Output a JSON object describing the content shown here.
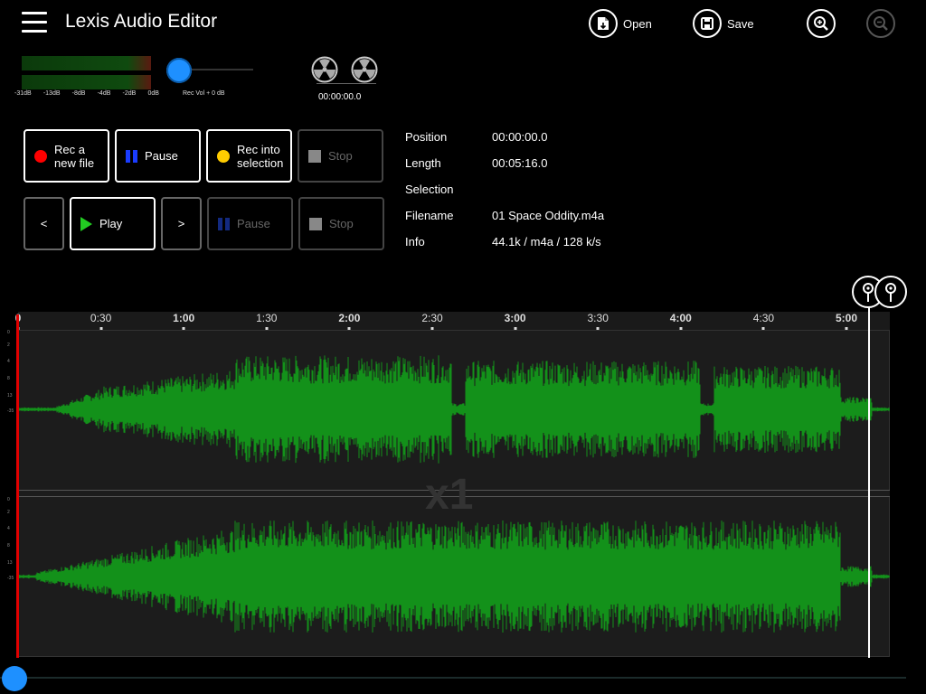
{
  "header": {
    "title": "Lexis Audio Editor",
    "open_label": "Open",
    "save_label": "Save",
    "icons": {
      "menu": "menu-icon",
      "open": "open-file-icon",
      "save": "save-icon",
      "zoom_in": "zoom-in-icon",
      "zoom_out": "zoom-out-icon"
    }
  },
  "recorder": {
    "meter_labels": [
      "-31dB",
      "-13dB",
      "-8dB",
      "-4dB",
      "-2dB",
      "0dB"
    ],
    "rec_vol_label": "Rec Vol + 0 dB",
    "rec_vol_level": 0.14,
    "tape_time": "00:00:00.0"
  },
  "transport": {
    "rec_new_label_1": "Rec a",
    "rec_new_label_2": "new file",
    "pause_label": "Pause",
    "rec_sel_label_1": "Rec into",
    "rec_sel_label_2": "selection",
    "stop_label": "Stop",
    "prev_label": "<",
    "play_label": "Play",
    "next_label": ">",
    "colors": {
      "rec": "#ff0000",
      "rec_sel": "#ffcc00",
      "play": "#22cc22",
      "pause": "#1a3cff",
      "pause_dim": "#132a80",
      "stop": "#888888",
      "stop_dim": "#555555"
    }
  },
  "info": {
    "position_label": "Position",
    "position_value": "00:00:00.0",
    "length_label": "Length",
    "length_value": "00:05:16.0",
    "selection_label": "Selection",
    "selection_value": "",
    "filename_label": "Filename",
    "filename_value": "01 Space Oddity.m4a",
    "info_label": "Info",
    "info_value": "44.1k / m4a / 128 k/s"
  },
  "timeline": {
    "ticks": [
      "0",
      "0:30",
      "1:00",
      "1:30",
      "2:00",
      "2:30",
      "3:00",
      "3:30",
      "4:00",
      "4:30",
      "5:00"
    ],
    "bold_ticks": [
      "0",
      "1:00",
      "2:00",
      "3:00",
      "4:00",
      "5:00"
    ],
    "db_labels": [
      "0",
      "2",
      "4",
      "8",
      "13",
      "-35"
    ],
    "zoom_factor": "x1",
    "playback_position": 0.0,
    "waveform_color": "#13911a"
  }
}
